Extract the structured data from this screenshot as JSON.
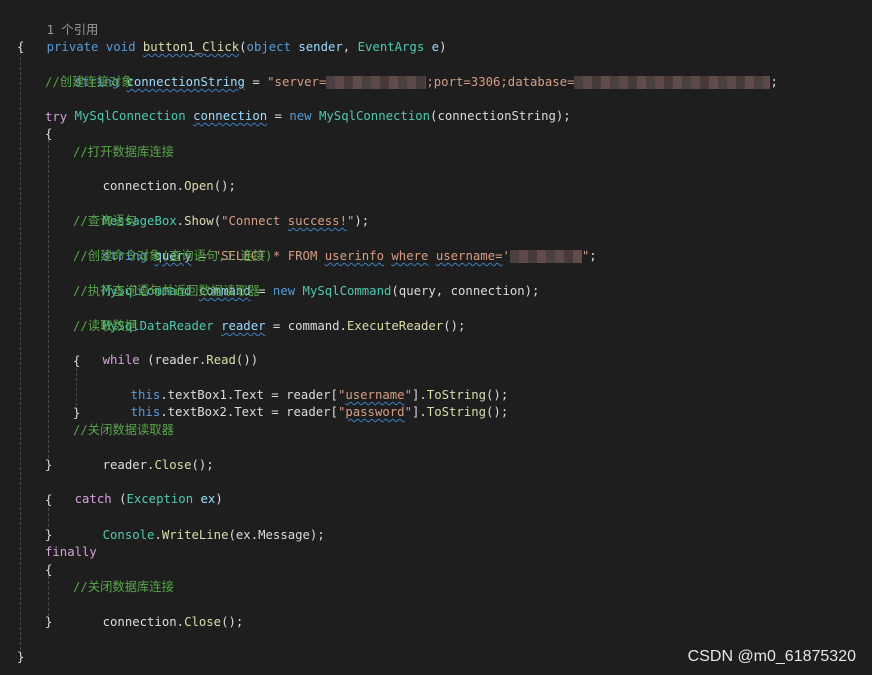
{
  "codelens": {
    "references": "1 个引用"
  },
  "code": {
    "sig_kw1": "private",
    "sig_kw2": "void",
    "sig_name": "button1_Click",
    "sig_open": "(",
    "sig_kw3": "object",
    "sig_p1": "sender",
    "sig_comma": ",",
    "sig_type": "EventArgs",
    "sig_p2": "e",
    "sig_close": ")",
    "brace_open": "{",
    "brace_close": "}",
    "l_conn_kw": "string",
    "l_conn_var": "connectionString",
    "l_conn_eq": "=",
    "l_conn_str1": "\"server=",
    "l_conn_str2": ";port=3306;database=",
    "l_conn_end": ";",
    "c_create_conn": "//创建连接对象",
    "l_mysqlconn_type": "MySqlConnection",
    "l_mysqlconn_var": "connection",
    "l_mysqlconn_eq": "=",
    "l_mysqlconn_new": "new",
    "l_mysqlconn_ctor": "MySqlConnection",
    "l_mysqlconn_args": "(connectionString);",
    "try_kw": "try",
    "c_open_conn": "//打开数据库连接",
    "l_open_obj": "connection.",
    "l_open_fn": "Open",
    "l_open_end": "();",
    "l_msg_cls": "MessageBox",
    "l_msg_dot": ".",
    "l_msg_fn": "Show",
    "l_msg_open": "(",
    "l_msg_str_a": "\"Connect",
    "l_msg_str_b": "success!",
    "l_msg_str_c": "\"",
    "l_msg_end": ");",
    "c_query": "//查询语句",
    "l_query_kw": "string",
    "l_query_var": "query",
    "l_query_eq": "=",
    "l_query_str1": "\"SELECT * FROM",
    "l_query_str2": "userinfo",
    "l_query_str3": "where",
    "l_query_str4": "username=",
    "l_query_str5": "'",
    "l_query_str6": "\"",
    "l_query_end": ";",
    "c_create_cmd": "//创建命令对象(查询语句,1 连接)",
    "l_cmd_type": "MySqlCommand",
    "l_cmd_var": "command",
    "l_cmd_eq": "=",
    "l_cmd_new": "new",
    "l_cmd_ctor": "MySqlCommand",
    "l_cmd_args": "(query, connection);",
    "c_exec": "//执行查询语句并返回数据读取器",
    "l_reader_type": "MySqlDataReader",
    "l_reader_var": "reader",
    "l_reader_eq": "=",
    "l_reader_obj": "command.",
    "l_reader_fn": "ExecuteReader",
    "l_reader_end": "();",
    "c_read": "//读取数据",
    "while_kw": "while",
    "l_while_open": "(reader.",
    "l_while_fn": "Read",
    "l_while_end": "())",
    "l_tb1_this": "this",
    "l_tb1_rest": ".textBox1.Text = reader[",
    "l_tb1_q1": "\"",
    "l_tb1_key": "username",
    "l_tb1_q2": "\"",
    "l_tb1_close": "].",
    "l_tb1_fn": "ToString",
    "l_tb1_end": "();",
    "l_tb2_this": "this",
    "l_tb2_rest": ".textBox2.Text = reader[",
    "l_tb2_q1": "\"",
    "l_tb2_key": "password",
    "l_tb2_q2": "\"",
    "l_tb2_close": "].",
    "l_tb2_fn": "ToString",
    "l_tb2_end": "();",
    "c_close_reader": "//关闭数据读取器",
    "l_rclose_obj": "reader.",
    "l_rclose_fn": "Close",
    "l_rclose_end": "();",
    "catch_kw": "catch",
    "l_catch_open": "(",
    "l_catch_type": "Exception",
    "l_catch_var": "ex",
    "l_catch_close": ")",
    "l_console_cls": "Console",
    "l_console_dot": ".",
    "l_console_fn": "WriteLine",
    "l_console_args": "(ex.Message);",
    "finally_kw": "finally",
    "c_close_conn": "//关闭数据库连接",
    "l_cclose_obj": "connection.",
    "l_cclose_fn": "Close",
    "l_cclose_end": "();"
  },
  "watermark": "CSDN @m0_61875320",
  "colors": {
    "background": "#1e1e1e",
    "keyword": "#569cd6",
    "control_keyword": "#d8a0df",
    "type": "#4ec9b0",
    "string": "#d69d85",
    "comment": "#57a64a",
    "variable": "#9cdcfe",
    "method": "#dcdcaa"
  }
}
